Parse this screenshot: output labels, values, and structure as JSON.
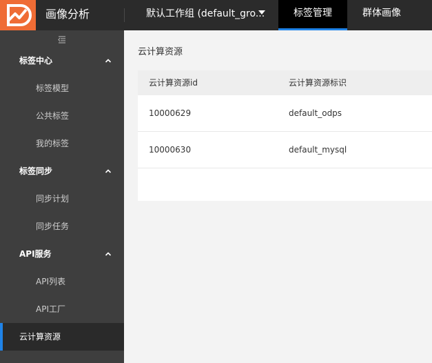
{
  "app": {
    "title": "画像分析",
    "workspace": "默认工作组 (default_gro..."
  },
  "nav": {
    "tabs": [
      {
        "label": "标签管理",
        "active": true
      },
      {
        "label": "群体画像",
        "active": false
      }
    ]
  },
  "sidebar": {
    "groups": [
      {
        "label": "标签中心",
        "items": [
          "标签模型",
          "公共标签",
          "我的标签"
        ]
      },
      {
        "label": "标签同步",
        "items": [
          "同步计划",
          "同步任务"
        ]
      },
      {
        "label": "API服务",
        "items": [
          "API列表",
          "API工厂"
        ]
      }
    ],
    "selected_item": "云计算资源"
  },
  "main": {
    "title": "云计算资源",
    "table": {
      "columns": [
        "云计算资源id",
        "云计算资源标识"
      ],
      "rows": [
        [
          "10000629",
          "default_odps"
        ],
        [
          "10000630",
          "default_mysql"
        ]
      ]
    }
  },
  "colors": {
    "accent": "#1f83e8",
    "brand": "#ef6c35",
    "topbar": "#2b2b2b",
    "sidebar": "#3e3e3e"
  },
  "icons": {
    "logo": "brand-logo-icon",
    "workspace_dropdown": "caret-down-icon",
    "collapse": "menu-collapse-icon",
    "group_toggle": "chevron-up-icon"
  }
}
